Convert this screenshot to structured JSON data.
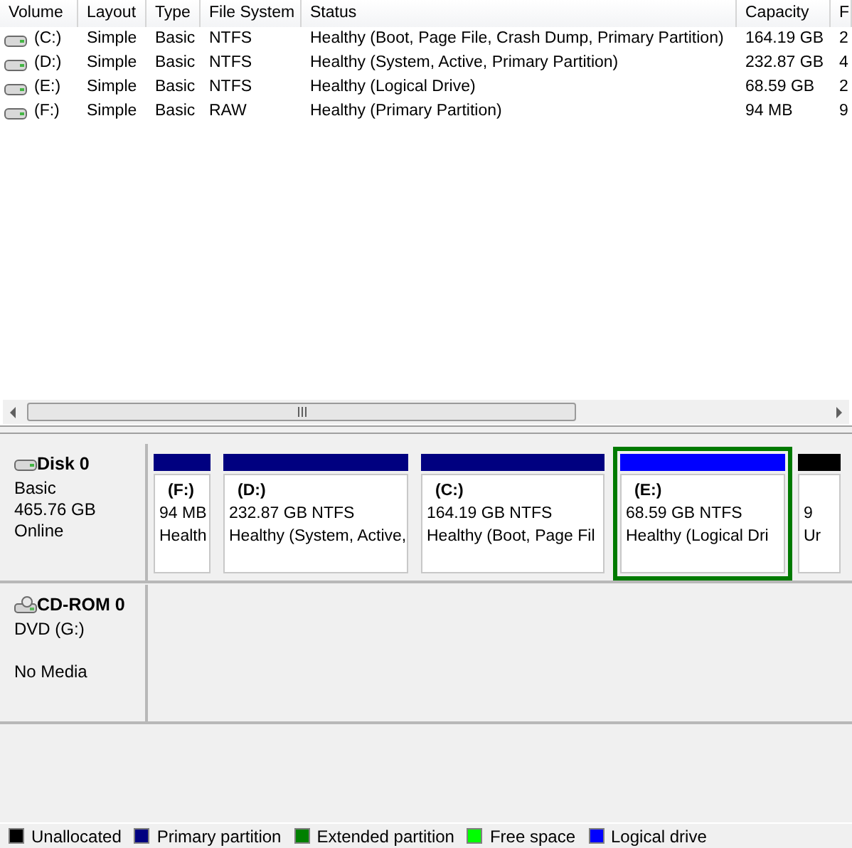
{
  "table": {
    "columns": [
      "Volume",
      "Layout",
      "Type",
      "File System",
      "Status",
      "Capacity",
      "F"
    ],
    "rows": [
      [
        "(C:)",
        "Simple",
        "Basic",
        "NTFS",
        "Healthy (Boot, Page File, Crash Dump, Primary Partition)",
        "164.19 GB",
        "2"
      ],
      [
        "(D:)",
        "Simple",
        "Basic",
        "NTFS",
        "Healthy (System, Active, Primary Partition)",
        "232.87 GB",
        "4"
      ],
      [
        "(E:)",
        "Simple",
        "Basic",
        "NTFS",
        "Healthy (Logical Drive)",
        "68.59 GB",
        "2"
      ],
      [
        "(F:)",
        "Simple",
        "Basic",
        "RAW",
        "Healthy (Primary Partition)",
        "94 MB",
        "9"
      ]
    ]
  },
  "disks": [
    {
      "kind": "disk",
      "name": "Disk 0",
      "lines": [
        "Basic",
        "465.76 GB",
        "Online"
      ],
      "partitions": [
        {
          "kind": "primary",
          "label": "(F:)",
          "size": "94 MB",
          "status": "Health",
          "selected": false
        },
        {
          "kind": "primary",
          "label": "(D:)",
          "size": "232.87 GB NTFS",
          "status": "Healthy (System, Active,",
          "selected": false
        },
        {
          "kind": "primary",
          "label": "(C:)",
          "size": "164.19 GB NTFS",
          "status": "Healthy (Boot, Page Fil",
          "selected": false
        },
        {
          "kind": "logical",
          "label": "(E:)",
          "size": "68.59 GB NTFS",
          "status": "Healthy (Logical Dri",
          "selected": true
        },
        {
          "kind": "unallocated",
          "size": "9",
          "status": "Ur",
          "selected": false
        }
      ]
    },
    {
      "kind": "cdrom",
      "name": "CD-ROM 0",
      "lines": [
        "DVD (G:)",
        "No Media"
      ]
    }
  ],
  "legend": [
    {
      "label": "Unallocated",
      "color": "#000000"
    },
    {
      "label": "Primary partition",
      "color": "#000080"
    },
    {
      "label": "Extended partition",
      "color": "#008000"
    },
    {
      "label": "Free space",
      "color": "#00ff00"
    },
    {
      "label": "Logical drive",
      "color": "#0000ff"
    }
  ]
}
